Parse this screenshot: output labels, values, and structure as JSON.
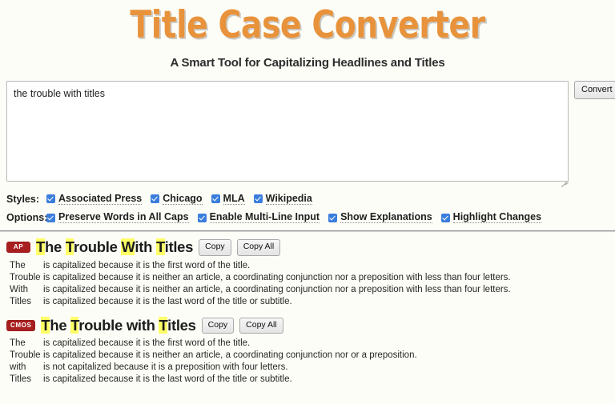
{
  "header": {
    "title": "Title Case Converter",
    "subtitle": "A Smart Tool for Capitalizing Headlines and Titles"
  },
  "input": {
    "value": "the trouble with titles",
    "placeholder": "",
    "convert_label": "Convert",
    "resize_icon": "resize-grip-icon"
  },
  "styles_row": {
    "label": "Styles:",
    "items": [
      {
        "label": "Associated Press",
        "checked": true
      },
      {
        "label": "Chicago",
        "checked": true
      },
      {
        "label": "MLA",
        "checked": true
      },
      {
        "label": "Wikipedia",
        "checked": true
      }
    ]
  },
  "options_row": {
    "label": "Options:",
    "items": [
      {
        "label": "Preserve Words in All Caps",
        "checked": true
      },
      {
        "label": "Enable Multi-Line Input",
        "checked": true
      },
      {
        "label": "Show Explanations",
        "checked": true
      },
      {
        "label": "Highlight Changes",
        "checked": true
      }
    ]
  },
  "buttons": {
    "copy": "Copy",
    "copy_all": "Copy All"
  },
  "colors": {
    "title_orange": "#e8933c",
    "badge_red": "#a81f1f",
    "highlight_yellow": "#ffff66",
    "checkbox_blue": "#3b7ddd",
    "page_background": "#fdfdf7"
  },
  "results": [
    {
      "badge": "AP",
      "title_parts": [
        {
          "text": "T",
          "highlight": true
        },
        {
          "text": "he ",
          "highlight": false
        },
        {
          "text": "T",
          "highlight": true
        },
        {
          "text": "rouble ",
          "highlight": false
        },
        {
          "text": "W",
          "highlight": true
        },
        {
          "text": "ith ",
          "highlight": false
        },
        {
          "text": "T",
          "highlight": true
        },
        {
          "text": "itles",
          "highlight": false
        }
      ],
      "title_plain": "The Trouble With Titles",
      "explanations": [
        {
          "word": "The",
          "text": "is capitalized because it is the first word of the title."
        },
        {
          "word": "Trouble",
          "text": "is capitalized because it is neither an article, a coordinating conjunction nor a preposition with less than four letters."
        },
        {
          "word": "With",
          "text": "is capitalized because it is neither an article, a coordinating conjunction nor a preposition with less than four letters."
        },
        {
          "word": "Titles",
          "text": "is capitalized because it is the last word of the title or subtitle."
        }
      ]
    },
    {
      "badge": "CMOS",
      "title_parts": [
        {
          "text": "T",
          "highlight": true
        },
        {
          "text": "he ",
          "highlight": false
        },
        {
          "text": "T",
          "highlight": true
        },
        {
          "text": "rouble with ",
          "highlight": false
        },
        {
          "text": "T",
          "highlight": true
        },
        {
          "text": "itles",
          "highlight": false
        }
      ],
      "title_plain": "The Trouble with Titles",
      "explanations": [
        {
          "word": "The",
          "text": "is capitalized because it is the first word of the title."
        },
        {
          "word": "Trouble",
          "text": "is capitalized because it is neither an article, a coordinating conjunction nor or a preposition."
        },
        {
          "word": "with",
          "text": "is not capitalized because it is a preposition with four letters."
        },
        {
          "word": "Titles",
          "text": "is capitalized because it is the last word of the title or subtitle."
        }
      ]
    }
  ]
}
